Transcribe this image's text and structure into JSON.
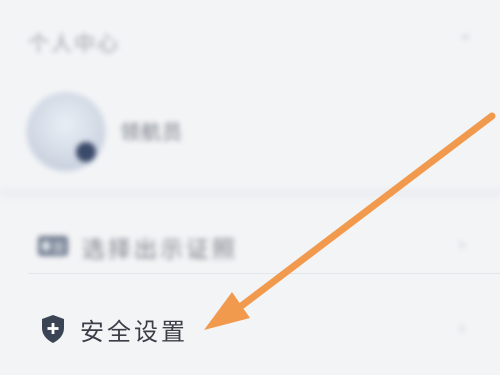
{
  "header": {
    "title": "个人中心"
  },
  "profile": {
    "name": "领航员"
  },
  "menu": {
    "items": [
      {
        "label": "选择出示证照",
        "icon": "id-card-icon"
      },
      {
        "label": "安全设置",
        "icon": "shield-icon"
      }
    ]
  },
  "colors": {
    "arrow": "#f19a4e",
    "shield": "#3b4455"
  }
}
